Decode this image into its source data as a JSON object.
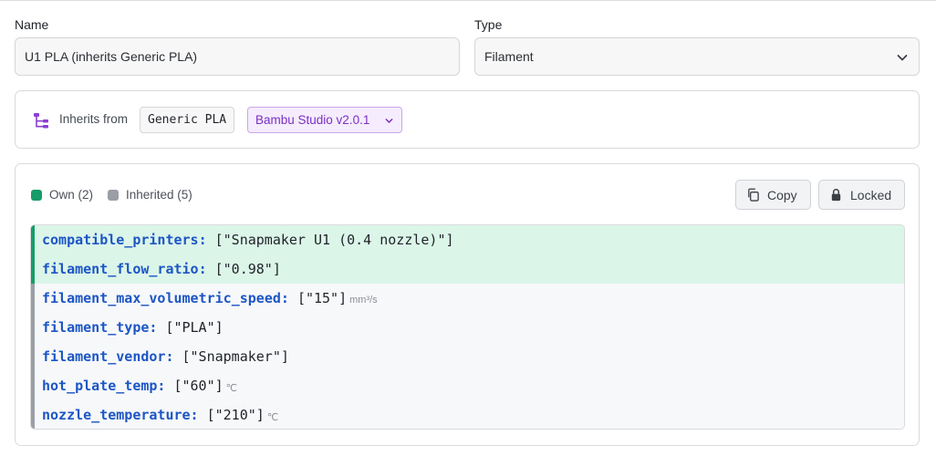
{
  "form": {
    "name_label": "Name",
    "name_value": "U1 PLA (inherits Generic PLA)",
    "type_label": "Type",
    "type_value": "Filament"
  },
  "inheritance": {
    "label": "Inherits from",
    "parent": "Generic PLA",
    "version": "Bambu Studio v2.0.1"
  },
  "properties": {
    "legend_own": "Own (2)",
    "legend_inherited": "Inherited (5)",
    "copy_label": "Copy",
    "locked_label": "Locked",
    "rows": [
      {
        "key": "compatible_printers:",
        "value": "[\"Snapmaker U1 (0.4 nozzle)\"]",
        "unit": "",
        "kind": "own"
      },
      {
        "key": "filament_flow_ratio:",
        "value": "[\"0.98\"]",
        "unit": "",
        "kind": "own"
      },
      {
        "key": "filament_max_volumetric_speed:",
        "value": "[\"15\"]",
        "unit": "mm³/s",
        "kind": "inherited"
      },
      {
        "key": "filament_type:",
        "value": "[\"PLA\"]",
        "unit": "",
        "kind": "inherited"
      },
      {
        "key": "filament_vendor:",
        "value": "[\"Snapmaker\"]",
        "unit": "",
        "kind": "inherited"
      },
      {
        "key": "hot_plate_temp:",
        "value": "[\"60\"]",
        "unit": "℃",
        "kind": "inherited"
      },
      {
        "key": "nozzle_temperature:",
        "value": "[\"210\"]",
        "unit": "℃",
        "kind": "inherited"
      }
    ]
  },
  "colors": {
    "own_accent": "#169c68",
    "own_bg": "#dcf5e9",
    "inherited_accent": "#9a9ea5",
    "key_blue": "#1c56c4",
    "version_purple": "#7b2fc4"
  },
  "icons": {
    "type_select": "chevron-down-icon",
    "inherit": "hierarchy-tree-icon",
    "version": "chevron-down-icon",
    "copy": "copy-icon",
    "locked": "lock-icon"
  }
}
